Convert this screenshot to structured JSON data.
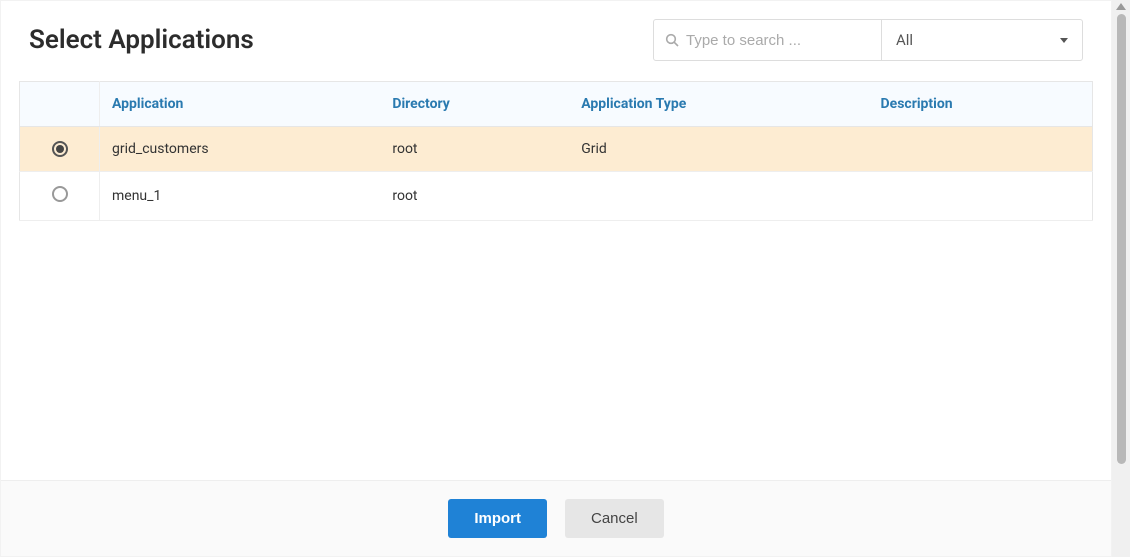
{
  "header": {
    "title": "Select Applications"
  },
  "search": {
    "placeholder": "Type to search ..."
  },
  "filter": {
    "selected": "All"
  },
  "table": {
    "columns": {
      "application": "Application",
      "directory": "Directory",
      "app_type": "Application Type",
      "description": "Description"
    },
    "rows": [
      {
        "selected": true,
        "application": "grid_customers",
        "directory": "root",
        "app_type": "Grid",
        "description": ""
      },
      {
        "selected": false,
        "application": "menu_1",
        "directory": "root",
        "app_type": "",
        "description": ""
      }
    ]
  },
  "footer": {
    "import_label": "Import",
    "cancel_label": "Cancel"
  }
}
